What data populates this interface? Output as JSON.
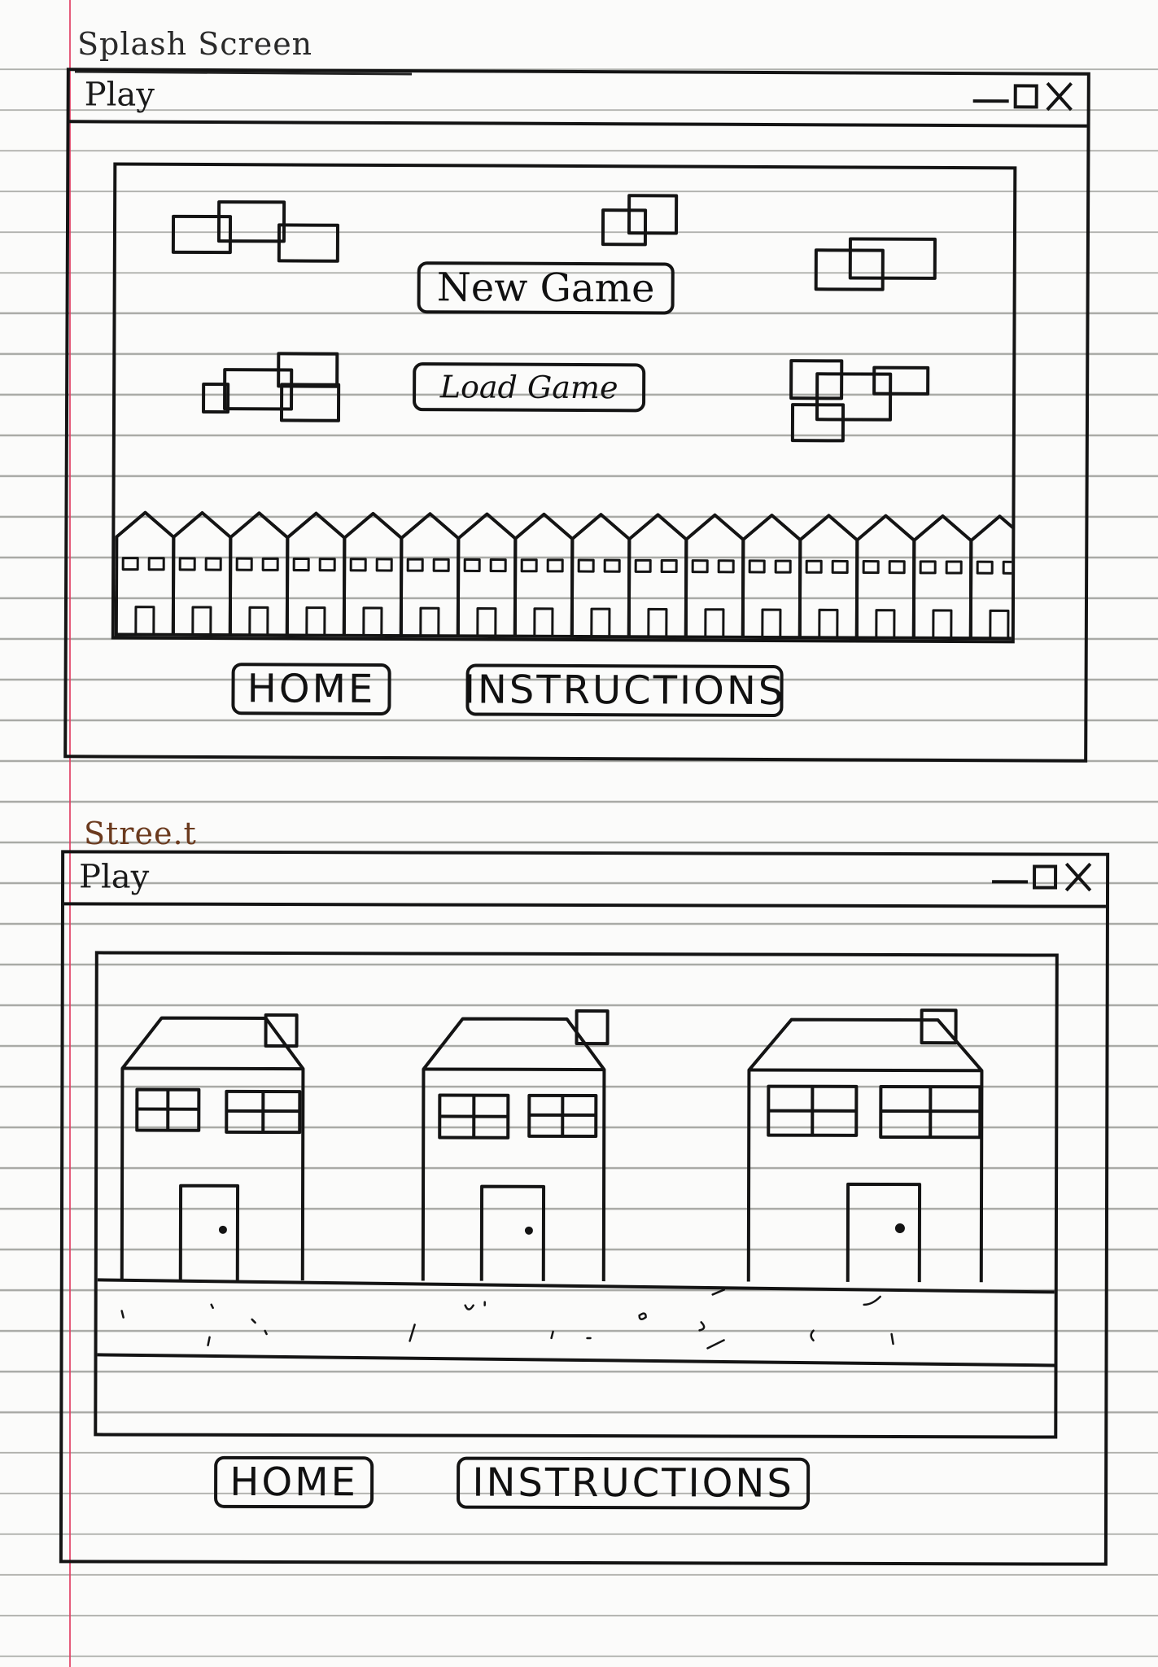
{
  "sheets": [
    {
      "title": "Splash Screen",
      "window": {
        "title": "Play",
        "buttons": {
          "new_game": "New Game",
          "load_game": "Load Game"
        },
        "nav": {
          "home": "HOME",
          "instructions": "INSTRUCTIONS"
        }
      }
    },
    {
      "title": "Stree.t",
      "window": {
        "title": "Play",
        "nav": {
          "home": "HOME",
          "instructions": "INSTRUCTIONS"
        }
      }
    }
  ],
  "colors": {
    "ink": "#141414",
    "margin_line": "#e03e63",
    "rule_line": "#a9aaa6",
    "paper": "#fbfbfa",
    "title2_ink": "#6b3a1e"
  },
  "icons": [
    "minimize-icon",
    "maximize-icon",
    "close-icon",
    "cloud-icon",
    "house-icon"
  ]
}
